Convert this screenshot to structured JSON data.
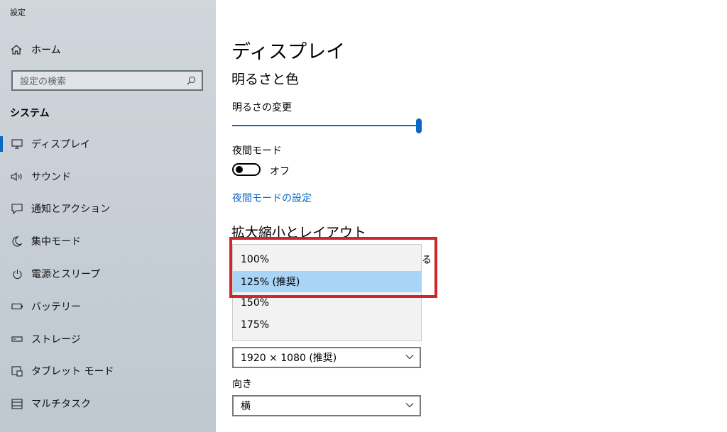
{
  "window": {
    "title": "設定"
  },
  "sidebar": {
    "home_label": "ホーム",
    "search_placeholder": "設定の検索",
    "section_label": "システム",
    "items": [
      {
        "label": "ディスプレイ",
        "icon": "monitor-icon",
        "active": true
      },
      {
        "label": "サウンド",
        "icon": "speaker-icon"
      },
      {
        "label": "通知とアクション",
        "icon": "notification-icon"
      },
      {
        "label": "集中モード",
        "icon": "moon-icon"
      },
      {
        "label": "電源とスリープ",
        "icon": "power-icon"
      },
      {
        "label": "バッテリー",
        "icon": "battery-icon"
      },
      {
        "label": "ストレージ",
        "icon": "storage-icon"
      },
      {
        "label": "タブレット モード",
        "icon": "tablet-icon"
      },
      {
        "label": "マルチタスク",
        "icon": "multitask-icon"
      }
    ]
  },
  "main": {
    "title": "ディスプレイ",
    "brightness_section": "明るさと色",
    "brightness_label": "明るさの変更",
    "brightness_level": 1.0,
    "night_mode_label": "夜間モード",
    "night_mode_state": "オフ",
    "night_mode_link": "夜間モードの設定",
    "scale_section": "拡大縮小とレイアウト",
    "scale_label_tail": "る",
    "scale_options": [
      "100%",
      "125% (推奨)",
      "150%",
      "175%"
    ],
    "scale_selected_index": 1,
    "resolution_value": "1920 × 1080 (推奨)",
    "orientation_label": "向き",
    "orientation_value": "横"
  },
  "colors": {
    "accent": "#0a67c4",
    "highlight_border": "#d1252e",
    "selected_option": "#a8d4f7"
  }
}
